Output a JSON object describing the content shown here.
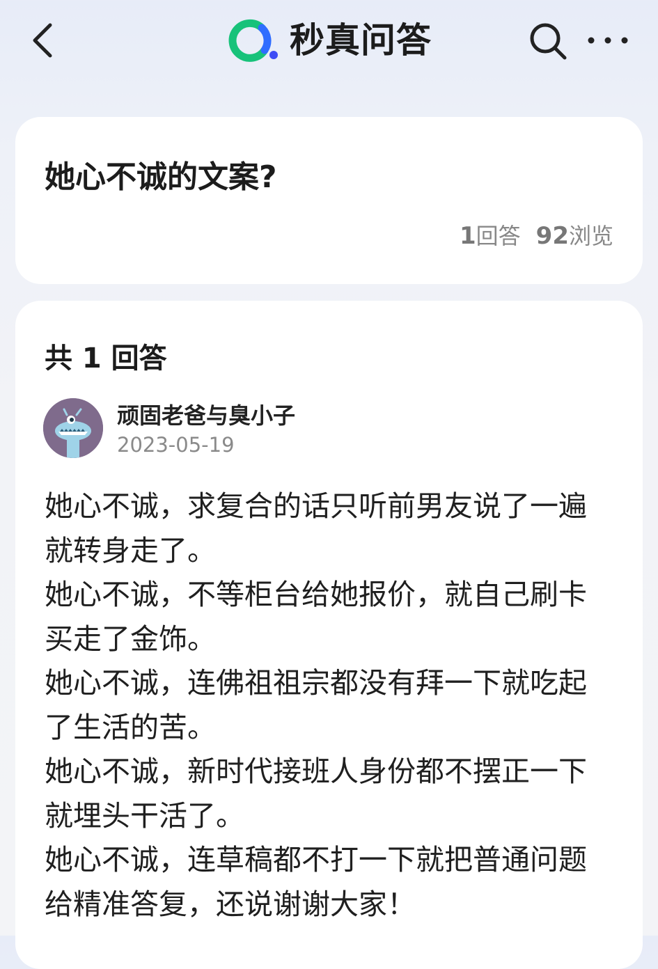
{
  "app": {
    "name": "秒真问答",
    "colors": {
      "logo_green": "#17c27a",
      "logo_blue": "#2f6dff",
      "logo_dot": "#3d4cf5"
    }
  },
  "header": {
    "back_icon": "chevron-left-icon",
    "search_icon": "search-icon",
    "more_icon": "more-dots-icon"
  },
  "question": {
    "title": "她心不诚的文案?",
    "answer_count": "1",
    "answer_count_label": "回答",
    "view_count": "92",
    "view_count_label": "浏览"
  },
  "answers_section": {
    "heading": "共 1 回答"
  },
  "answer": {
    "author": "顽固老爸与臭小子",
    "date": "2023-05-19",
    "lines": [
      "她心不诚，求复合的话只听前男友说了一遍",
      "就转身走了。",
      "她心不诚，不等柜台给她报价，就自己刷卡",
      "买走了金饰。",
      "她心不诚，连佛祖祖宗都没有拜一下就吃起",
      "了生活的苦。",
      "她心不诚，新时代接班人身份都不摆正一下",
      "就埋头干活了。",
      "她心不诚，连草稿都不打一下就把普通问题",
      "给精准答复，还说谢谢大家！"
    ]
  }
}
